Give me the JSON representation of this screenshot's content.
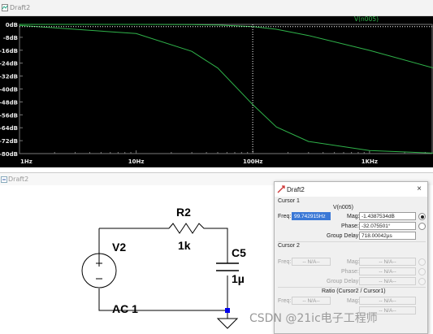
{
  "plot_window": {
    "title": "Draft2",
    "trace_label": "V(n005)",
    "y_ticks": [
      "0dB",
      "-8dB",
      "-16dB",
      "-24dB",
      "-32dB",
      "-40dB",
      "-48dB",
      "-56dB",
      "-64dB",
      "-72dB",
      "-80dB"
    ],
    "x_ticks": [
      "1Hz",
      "10Hz",
      "100Hz",
      "1KHz"
    ],
    "colors": {
      "background": "#000000",
      "trace": "#2fb34a",
      "grid": "#7a7a7a",
      "cursor": "#ffffff"
    }
  },
  "chart_data": {
    "type": "line",
    "title": "",
    "xlabel": "",
    "ylabel": "",
    "x_scale": "log",
    "xlim": [
      1,
      3500
    ],
    "ylim": [
      -80,
      0
    ],
    "series": [
      {
        "name": "V(n005)",
        "x": [
          1,
          10,
          30,
          50,
          100,
          159,
          300,
          1000,
          3500
        ],
        "values": [
          0,
          -0.02,
          -0.15,
          -0.4,
          -1.4,
          -3.0,
          -6.9,
          -16.1,
          -26.9
        ]
      },
      {
        "x": [
          1,
          10,
          30,
          50,
          100,
          159,
          300,
          1000,
          3500
        ],
        "values": [
          -0.6,
          -5.7,
          -16.7,
          -27.0,
          -49.7,
          -63.5,
          -72.5,
          -78.1,
          -79.7
        ]
      }
    ],
    "cursor_x": 99.74
  },
  "schematic_window": {
    "title": "Draft2",
    "components": {
      "r_name": "R2",
      "r_value": "1k",
      "c_name": "C5",
      "c_value": "1µ",
      "v_name": "V2",
      "v_value": "AC 1"
    }
  },
  "cursor_dialog": {
    "title": "Draft2",
    "close": "×",
    "cursor1_label": "Cursor 1",
    "trace": "V(n005)",
    "freq_label": "Freq:",
    "freq_value": "99.742915Hz",
    "mag_label": "Mag:",
    "mag_value": "-1.4387534dB",
    "phase_label": "Phase:",
    "phase_value": "-32.075501°",
    "group_delay_label": "Group Delay:",
    "group_delay_value": "718.00042µs",
    "cursor2_label": "Cursor 2",
    "na": "-- N/A--",
    "ratio_label": "Ratio (Cursor2 / Cursor1)"
  },
  "watermark": "CSDN @21ic电子工程师"
}
